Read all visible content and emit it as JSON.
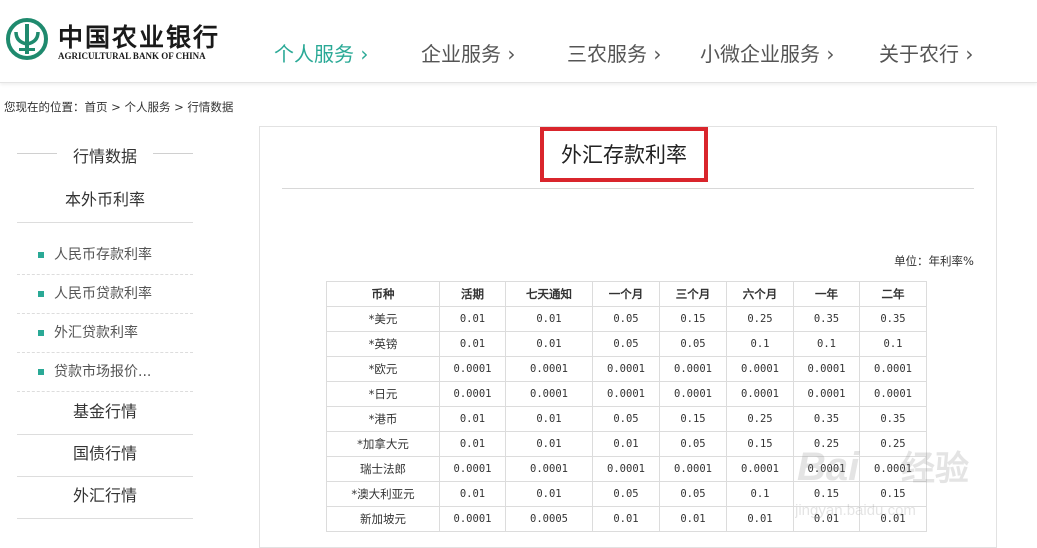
{
  "header": {
    "logo_cn": "中国农业银行",
    "logo_en": "AGRICULTURAL BANK OF CHINA",
    "nav": [
      "个人服务 ›",
      "企业服务 ›",
      "三农服务 ›",
      "小微企业服务 ›",
      "关于农行 ›"
    ],
    "active_index": 0
  },
  "breadcrumb": "您现在的位置：首页 > 个人服务 > 行情数据",
  "sidebar": {
    "top": "行情数据",
    "section1": "本外币利率",
    "items": [
      "人民币存款利率",
      "人民币贷款利率",
      "外汇贷款利率",
      "贷款市场报价..."
    ],
    "section2": "基金行情",
    "section3": "国债行情",
    "section4": "外汇行情"
  },
  "main": {
    "title": "外汇存款利率",
    "unit": "单位：年利率%",
    "columns": [
      "币种",
      "活期",
      "七天通知",
      "一个月",
      "三个月",
      "六个月",
      "一年",
      "二年"
    ],
    "rows": [
      [
        "*美元",
        "0.01",
        "0.01",
        "0.05",
        "0.15",
        "0.25",
        "0.35",
        "0.35"
      ],
      [
        "*英镑",
        "0.01",
        "0.01",
        "0.05",
        "0.05",
        "0.1",
        "0.1",
        "0.1"
      ],
      [
        "*欧元",
        "0.0001",
        "0.0001",
        "0.0001",
        "0.0001",
        "0.0001",
        "0.0001",
        "0.0001"
      ],
      [
        "*日元",
        "0.0001",
        "0.0001",
        "0.0001",
        "0.0001",
        "0.0001",
        "0.0001",
        "0.0001"
      ],
      [
        "*港币",
        "0.01",
        "0.01",
        "0.05",
        "0.15",
        "0.25",
        "0.35",
        "0.35"
      ],
      [
        "*加拿大元",
        "0.01",
        "0.01",
        "0.01",
        "0.05",
        "0.15",
        "0.25",
        "0.25"
      ],
      [
        "瑞士法郎",
        "0.0001",
        "0.0001",
        "0.0001",
        "0.0001",
        "0.0001",
        "0.0001",
        "0.0001"
      ],
      [
        "*澳大利亚元",
        "0.01",
        "0.01",
        "0.05",
        "0.05",
        "0.1",
        "0.15",
        "0.15"
      ],
      [
        "新加坡元",
        "0.0001",
        "0.0005",
        "0.01",
        "0.01",
        "0.01",
        "0.01",
        "0.01"
      ]
    ]
  },
  "watermark": {
    "logo": "Bai",
    "cn": "经验",
    "url": "jingyan.baidu.com"
  },
  "colors": {
    "accent": "#2aa996",
    "highlight": "#d9252c",
    "logo_green": "#1f8a6e"
  }
}
